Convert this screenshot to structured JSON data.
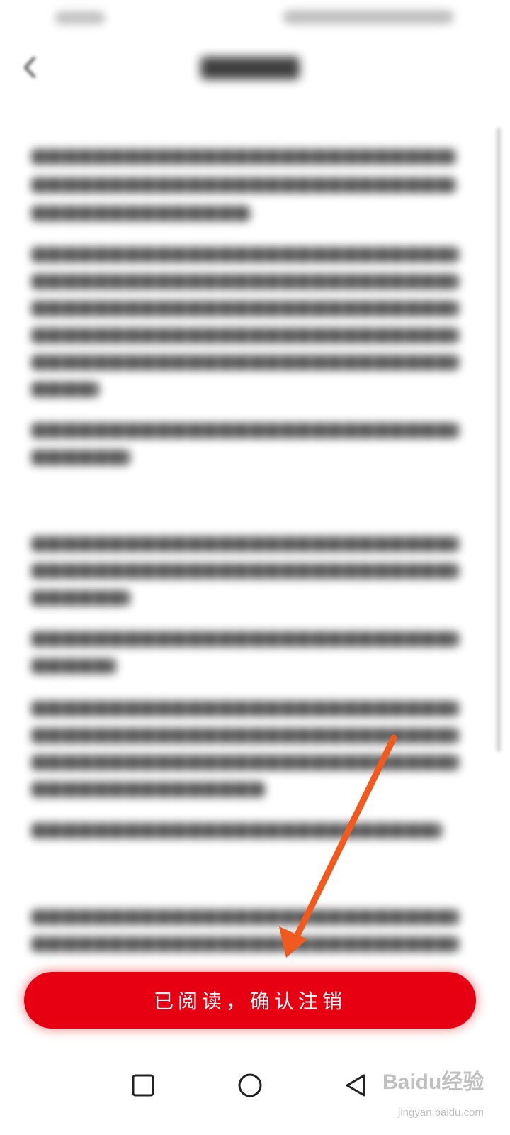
{
  "confirm_button": {
    "label": "已阅读，确认注销",
    "color": "#e60012"
  },
  "annotation": {
    "arrow_color": "#f05a1e"
  },
  "nav": {
    "recent_icon": "square-icon",
    "home_icon": "circle-icon",
    "back_icon": "triangle-back-icon"
  },
  "watermark": {
    "logo": "Baidu经验",
    "url": "jingyan.baidu.com"
  }
}
